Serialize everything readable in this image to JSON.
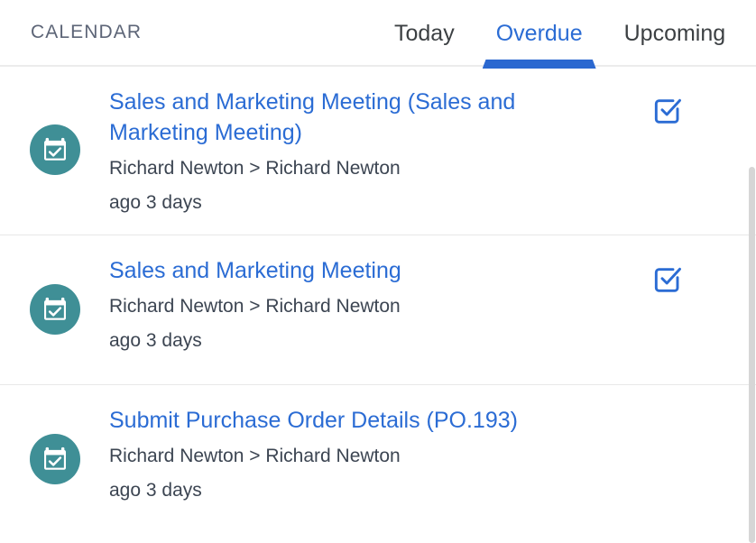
{
  "header": {
    "title": "CALENDAR",
    "tabs": [
      {
        "label": "Today",
        "active": false
      },
      {
        "label": "Overdue",
        "active": true
      },
      {
        "label": "Upcoming",
        "active": false
      }
    ]
  },
  "colors": {
    "accent_blue": "#2b6cd4",
    "indicator_blue": "#2b68d0",
    "avatar_teal": "#3f8f96",
    "title_gray": "#5d6577",
    "body_gray": "#3c4552",
    "divider": "#e8e8e8"
  },
  "icons": {
    "avatar": "calendar-check-icon",
    "action": "checkbox-checked-icon"
  },
  "list": {
    "items": [
      {
        "title": "Sales and Marketing Meeting (Sales and Marketing Meeting)",
        "subtitle": "Richard Newton > Richard Newton",
        "time": "ago 3 days",
        "has_action": true
      },
      {
        "title": "Sales and Marketing Meeting",
        "subtitle": "Richard Newton > Richard Newton",
        "time": "ago 3 days",
        "has_action": true
      },
      {
        "title": "Submit Purchase Order Details (PO.193)",
        "subtitle": "Richard Newton > Richard Newton",
        "time": "ago 3 days",
        "has_action": false
      }
    ]
  }
}
